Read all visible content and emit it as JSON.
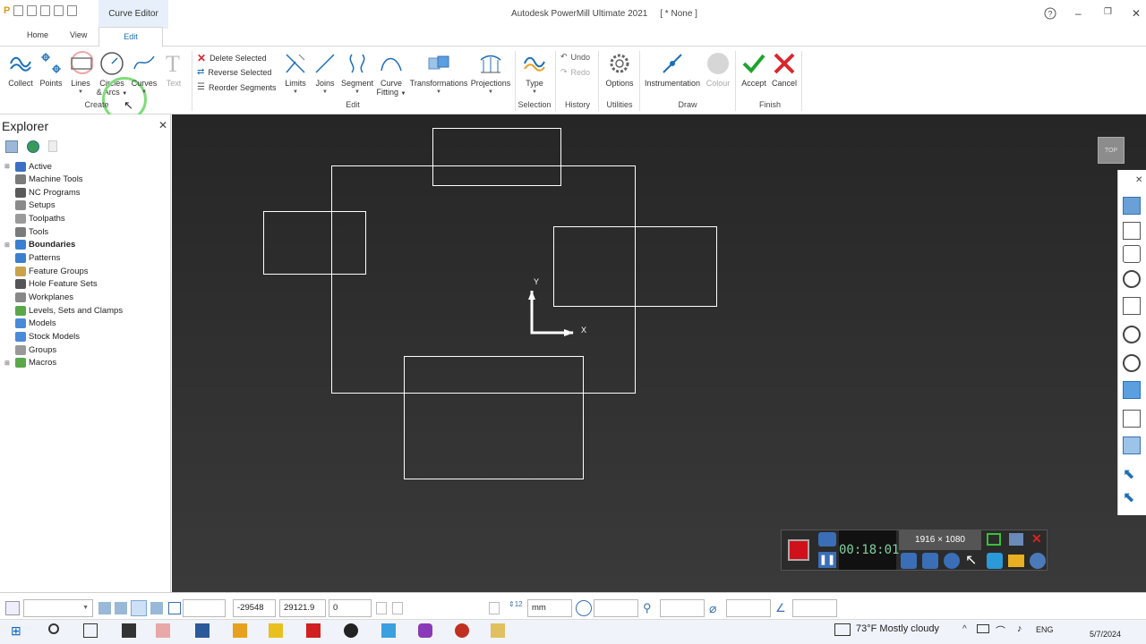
{
  "titlebar": {
    "context_tab": "Curve Editor",
    "app_title": "Autodesk PowerMill Ultimate 2021",
    "document": "[ * None ]",
    "help_icon": "help-icon",
    "restore_icon": "restore-icon",
    "close_icon": "close-icon"
  },
  "tabs": {
    "home": "Home",
    "view": "View",
    "edit": "Edit"
  },
  "ribbon": {
    "create": {
      "group_label": "Create",
      "collect": "Collect",
      "points": "Points",
      "lines": "Lines",
      "circles_line1": "Circles",
      "circles_line2": "& Arcs",
      "curves": "Curves",
      "text": "Text"
    },
    "edit": {
      "group_label": "Edit",
      "delete_selected": "Delete Selected",
      "reverse_selected": "Reverse Selected",
      "reorder_segments": "Reorder Segments",
      "limits": "Limits",
      "joins": "Joins",
      "segment": "Segment",
      "curve_line1": "Curve",
      "curve_line2": "Fitting",
      "transformations": "Transformations",
      "projections": "Projections"
    },
    "selection": {
      "group_label": "Selection",
      "type": "Type"
    },
    "history": {
      "group_label": "History",
      "undo": "Undo",
      "redo": "Redo"
    },
    "utilities": {
      "group_label": "Utilities",
      "options": "Options"
    },
    "draw": {
      "group_label": "Draw",
      "instrumentation": "Instrumentation",
      "colour": "Colour"
    },
    "finish": {
      "group_label": "Finish",
      "accept": "Accept",
      "cancel": "Cancel"
    }
  },
  "explorer": {
    "title": "Explorer",
    "items": [
      {
        "label": "Active",
        "expandable": true,
        "bold": false,
        "color": "#3a6fc4"
      },
      {
        "label": "Machine Tools",
        "expandable": false,
        "bold": false,
        "color": "#7a7a7a"
      },
      {
        "label": "NC Programs",
        "expandable": false,
        "bold": false,
        "color": "#5a5a5a"
      },
      {
        "label": "Setups",
        "expandable": false,
        "bold": false,
        "color": "#8a8a8a"
      },
      {
        "label": "Toolpaths",
        "expandable": false,
        "bold": false,
        "color": "#9a9a9a"
      },
      {
        "label": "Tools",
        "expandable": false,
        "bold": false,
        "color": "#7a7a7a"
      },
      {
        "label": "Boundaries",
        "expandable": true,
        "bold": true,
        "color": "#3a7fd0"
      },
      {
        "label": "Patterns",
        "expandable": false,
        "bold": false,
        "color": "#3a7fd0"
      },
      {
        "label": "Feature Groups",
        "expandable": false,
        "bold": false,
        "color": "#c9a24a"
      },
      {
        "label": "Hole Feature Sets",
        "expandable": false,
        "bold": false,
        "color": "#555555"
      },
      {
        "label": "Workplanes",
        "expandable": false,
        "bold": false,
        "color": "#888888"
      },
      {
        "label": "Levels, Sets and Clamps",
        "expandable": false,
        "bold": false,
        "color": "#5aa84a"
      },
      {
        "label": "Models",
        "expandable": false,
        "bold": false,
        "color": "#4a8ad8"
      },
      {
        "label": "Stock Models",
        "expandable": false,
        "bold": false,
        "color": "#4a8ad8"
      },
      {
        "label": "Groups",
        "expandable": false,
        "bold": false,
        "color": "#999999"
      },
      {
        "label": "Macros",
        "expandable": true,
        "bold": false,
        "color": "#5aa84a"
      }
    ]
  },
  "viewport": {
    "axis_y": "Y",
    "axis_x": "X",
    "view_cube": "TOP",
    "background_top": "#262626",
    "background_bottom": "#3a3a3a",
    "curve_color": "#ffffff"
  },
  "statusbar": {
    "x": "-29548",
    "y": "29121.9",
    "z": "0",
    "units": "mm"
  },
  "recorder": {
    "timer": "00:18:01",
    "resolution": "1916 × 1080"
  },
  "taskbar": {
    "weather": "73°F  Mostly cloudy",
    "language": "ENG",
    "date": "5/7/2024"
  },
  "colors": {
    "accent": "#1d6fb8",
    "accept_green": "#1fa32f",
    "cancel_red": "#d9262c"
  }
}
